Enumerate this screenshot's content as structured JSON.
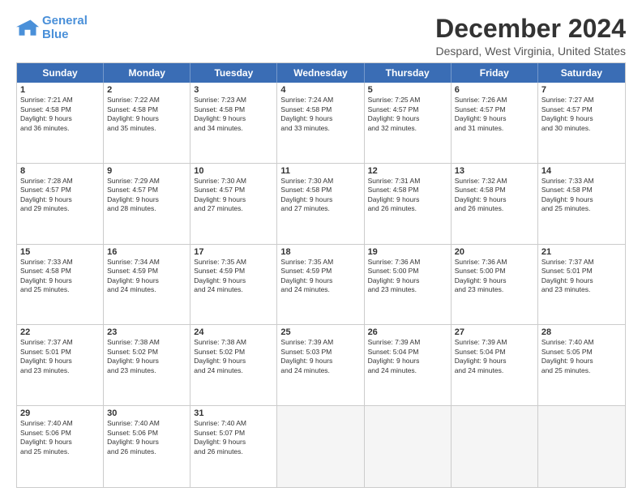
{
  "logo": {
    "line1": "General",
    "line2": "Blue"
  },
  "title": "December 2024",
  "location": "Despard, West Virginia, United States",
  "header_days": [
    "Sunday",
    "Monday",
    "Tuesday",
    "Wednesday",
    "Thursday",
    "Friday",
    "Saturday"
  ],
  "weeks": [
    [
      {
        "num": "1",
        "lines": [
          "Sunrise: 7:21 AM",
          "Sunset: 4:58 PM",
          "Daylight: 9 hours",
          "and 36 minutes."
        ]
      },
      {
        "num": "2",
        "lines": [
          "Sunrise: 7:22 AM",
          "Sunset: 4:58 PM",
          "Daylight: 9 hours",
          "and 35 minutes."
        ]
      },
      {
        "num": "3",
        "lines": [
          "Sunrise: 7:23 AM",
          "Sunset: 4:58 PM",
          "Daylight: 9 hours",
          "and 34 minutes."
        ]
      },
      {
        "num": "4",
        "lines": [
          "Sunrise: 7:24 AM",
          "Sunset: 4:58 PM",
          "Daylight: 9 hours",
          "and 33 minutes."
        ]
      },
      {
        "num": "5",
        "lines": [
          "Sunrise: 7:25 AM",
          "Sunset: 4:57 PM",
          "Daylight: 9 hours",
          "and 32 minutes."
        ]
      },
      {
        "num": "6",
        "lines": [
          "Sunrise: 7:26 AM",
          "Sunset: 4:57 PM",
          "Daylight: 9 hours",
          "and 31 minutes."
        ]
      },
      {
        "num": "7",
        "lines": [
          "Sunrise: 7:27 AM",
          "Sunset: 4:57 PM",
          "Daylight: 9 hours",
          "and 30 minutes."
        ]
      }
    ],
    [
      {
        "num": "8",
        "lines": [
          "Sunrise: 7:28 AM",
          "Sunset: 4:57 PM",
          "Daylight: 9 hours",
          "and 29 minutes."
        ]
      },
      {
        "num": "9",
        "lines": [
          "Sunrise: 7:29 AM",
          "Sunset: 4:57 PM",
          "Daylight: 9 hours",
          "and 28 minutes."
        ]
      },
      {
        "num": "10",
        "lines": [
          "Sunrise: 7:30 AM",
          "Sunset: 4:57 PM",
          "Daylight: 9 hours",
          "and 27 minutes."
        ]
      },
      {
        "num": "11",
        "lines": [
          "Sunrise: 7:30 AM",
          "Sunset: 4:58 PM",
          "Daylight: 9 hours",
          "and 27 minutes."
        ]
      },
      {
        "num": "12",
        "lines": [
          "Sunrise: 7:31 AM",
          "Sunset: 4:58 PM",
          "Daylight: 9 hours",
          "and 26 minutes."
        ]
      },
      {
        "num": "13",
        "lines": [
          "Sunrise: 7:32 AM",
          "Sunset: 4:58 PM",
          "Daylight: 9 hours",
          "and 26 minutes."
        ]
      },
      {
        "num": "14",
        "lines": [
          "Sunrise: 7:33 AM",
          "Sunset: 4:58 PM",
          "Daylight: 9 hours",
          "and 25 minutes."
        ]
      }
    ],
    [
      {
        "num": "15",
        "lines": [
          "Sunrise: 7:33 AM",
          "Sunset: 4:58 PM",
          "Daylight: 9 hours",
          "and 25 minutes."
        ]
      },
      {
        "num": "16",
        "lines": [
          "Sunrise: 7:34 AM",
          "Sunset: 4:59 PM",
          "Daylight: 9 hours",
          "and 24 minutes."
        ]
      },
      {
        "num": "17",
        "lines": [
          "Sunrise: 7:35 AM",
          "Sunset: 4:59 PM",
          "Daylight: 9 hours",
          "and 24 minutes."
        ]
      },
      {
        "num": "18",
        "lines": [
          "Sunrise: 7:35 AM",
          "Sunset: 4:59 PM",
          "Daylight: 9 hours",
          "and 24 minutes."
        ]
      },
      {
        "num": "19",
        "lines": [
          "Sunrise: 7:36 AM",
          "Sunset: 5:00 PM",
          "Daylight: 9 hours",
          "and 23 minutes."
        ]
      },
      {
        "num": "20",
        "lines": [
          "Sunrise: 7:36 AM",
          "Sunset: 5:00 PM",
          "Daylight: 9 hours",
          "and 23 minutes."
        ]
      },
      {
        "num": "21",
        "lines": [
          "Sunrise: 7:37 AM",
          "Sunset: 5:01 PM",
          "Daylight: 9 hours",
          "and 23 minutes."
        ]
      }
    ],
    [
      {
        "num": "22",
        "lines": [
          "Sunrise: 7:37 AM",
          "Sunset: 5:01 PM",
          "Daylight: 9 hours",
          "and 23 minutes."
        ]
      },
      {
        "num": "23",
        "lines": [
          "Sunrise: 7:38 AM",
          "Sunset: 5:02 PM",
          "Daylight: 9 hours",
          "and 23 minutes."
        ]
      },
      {
        "num": "24",
        "lines": [
          "Sunrise: 7:38 AM",
          "Sunset: 5:02 PM",
          "Daylight: 9 hours",
          "and 24 minutes."
        ]
      },
      {
        "num": "25",
        "lines": [
          "Sunrise: 7:39 AM",
          "Sunset: 5:03 PM",
          "Daylight: 9 hours",
          "and 24 minutes."
        ]
      },
      {
        "num": "26",
        "lines": [
          "Sunrise: 7:39 AM",
          "Sunset: 5:04 PM",
          "Daylight: 9 hours",
          "and 24 minutes."
        ]
      },
      {
        "num": "27",
        "lines": [
          "Sunrise: 7:39 AM",
          "Sunset: 5:04 PM",
          "Daylight: 9 hours",
          "and 24 minutes."
        ]
      },
      {
        "num": "28",
        "lines": [
          "Sunrise: 7:40 AM",
          "Sunset: 5:05 PM",
          "Daylight: 9 hours",
          "and 25 minutes."
        ]
      }
    ],
    [
      {
        "num": "29",
        "lines": [
          "Sunrise: 7:40 AM",
          "Sunset: 5:06 PM",
          "Daylight: 9 hours",
          "and 25 minutes."
        ]
      },
      {
        "num": "30",
        "lines": [
          "Sunrise: 7:40 AM",
          "Sunset: 5:06 PM",
          "Daylight: 9 hours",
          "and 26 minutes."
        ]
      },
      {
        "num": "31",
        "lines": [
          "Sunrise: 7:40 AM",
          "Sunset: 5:07 PM",
          "Daylight: 9 hours",
          "and 26 minutes."
        ]
      },
      {
        "num": "",
        "lines": []
      },
      {
        "num": "",
        "lines": []
      },
      {
        "num": "",
        "lines": []
      },
      {
        "num": "",
        "lines": []
      }
    ]
  ]
}
